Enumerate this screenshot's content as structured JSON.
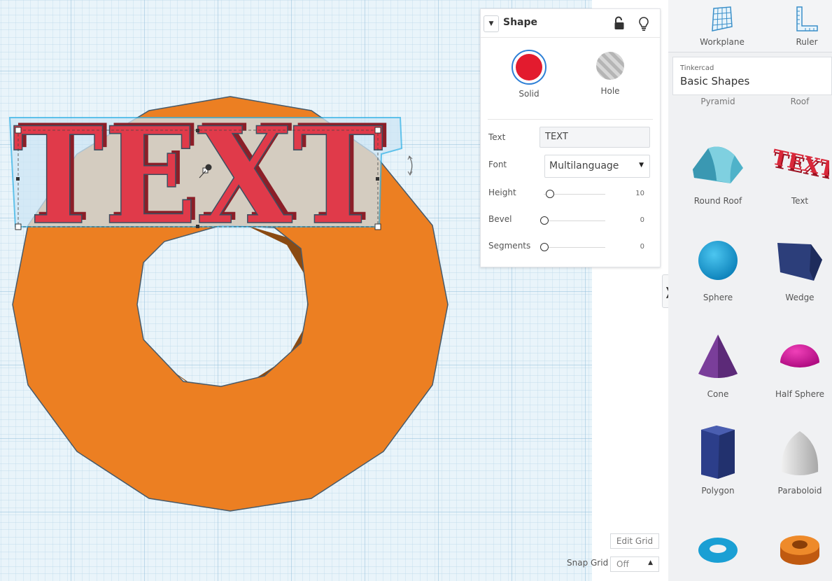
{
  "inspector": {
    "title": "Shape",
    "solid_label": "Solid",
    "hole_label": "Hole",
    "text_label": "Text",
    "text_value": "TEXT",
    "font_label": "Font",
    "font_value": "Multilanguage",
    "height_label": "Height",
    "height_value": "10",
    "bevel_label": "Bevel",
    "bevel_value": "0",
    "segments_label": "Segments",
    "segments_value": "0",
    "solid_color": "#e31b2e"
  },
  "canvas": {
    "text_object": "TEXT",
    "text_color": "#e03a4a",
    "ring_color": "#ec7f22"
  },
  "toolbar": {
    "workplane_label": "Workplane",
    "ruler_label": "Ruler"
  },
  "library": {
    "brand": "Tinkercad",
    "name": "Basic Shapes",
    "partial_left": "Pyramid",
    "partial_right": "Roof",
    "shapes": [
      {
        "label": "Round Roof",
        "icon": "round-roof-icon"
      },
      {
        "label": "Text",
        "icon": "text-shape-icon"
      },
      {
        "label": "Sphere",
        "icon": "sphere-icon"
      },
      {
        "label": "Wedge",
        "icon": "wedge-icon"
      },
      {
        "label": "Cone",
        "icon": "cone-icon"
      },
      {
        "label": "Half Sphere",
        "icon": "half-sphere-icon"
      },
      {
        "label": "Polygon",
        "icon": "polygon-icon"
      },
      {
        "label": "Paraboloid",
        "icon": "paraboloid-icon"
      },
      {
        "label": "",
        "icon": "torus-icon"
      },
      {
        "label": "",
        "icon": "tube-icon"
      }
    ]
  },
  "grid": {
    "edit_label": "Edit Grid",
    "snap_label": "Snap Grid",
    "snap_value": "Off"
  }
}
